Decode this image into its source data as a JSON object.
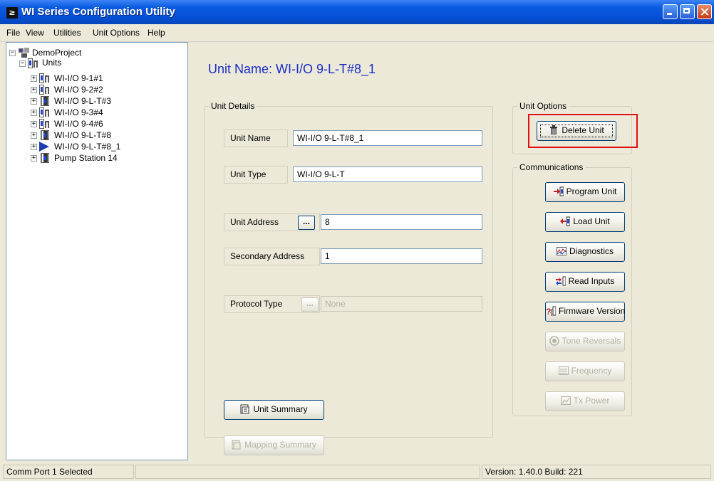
{
  "window": {
    "title": "WI Series Configuration Utility",
    "app_icon": "≥"
  },
  "menu": [
    "File",
    "View",
    "Utilities",
    "Unit Options",
    "Help"
  ],
  "tree": {
    "project": "DemoProject",
    "units_folder": "Units",
    "items": [
      {
        "label": "WI-I/O 9-1#1",
        "icon": "multi-unit-icon"
      },
      {
        "label": "WI-I/O 9-2#2",
        "icon": "multi-unit-icon"
      },
      {
        "label": "WI-I/O 9-L-T#3",
        "icon": "unit-icon"
      },
      {
        "label": "WI-I/O 9-3#4",
        "icon": "multi-unit-icon"
      },
      {
        "label": "WI-I/O 9-4#6",
        "icon": "multi-unit-icon"
      },
      {
        "label": "WI-I/O 9-L-T#8",
        "icon": "unit-icon"
      },
      {
        "label": "WI-I/O 9-L-T#8_1",
        "icon": "selected-arrow-icon"
      },
      {
        "label": "Pump Station 14",
        "icon": "unit-icon"
      }
    ]
  },
  "main": {
    "heading": "Unit Name: WI-I/O 9-L-T#8_1",
    "unit_details": {
      "title": "Unit Details",
      "unit_name_label": "Unit Name",
      "unit_name_value": "WI-I/O 9-L-T#8_1",
      "unit_type_label": "Unit Type",
      "unit_type_value": "WI-I/O 9-L-T",
      "unit_address_label": "Unit Address",
      "unit_address_button": "...",
      "unit_address_value": "8",
      "secondary_address_label": "Secondary Address",
      "secondary_address_value": "1",
      "protocol_type_label": "Protocol Type",
      "protocol_type_button": "...",
      "protocol_type_value": "None",
      "unit_summary_button": "Unit Summary",
      "mapping_summary_button": "Mapping Summary"
    },
    "unit_options": {
      "title": "Unit Options",
      "delete_button": "Delete Unit"
    },
    "communications": {
      "title": "Communications",
      "buttons": [
        {
          "label": "Program Unit",
          "enabled": true
        },
        {
          "label": "Load Unit",
          "enabled": true
        },
        {
          "label": "Diagnostics",
          "enabled": true
        },
        {
          "label": "Read Inputs",
          "enabled": true
        },
        {
          "label": "Firmware Version",
          "enabled": true
        },
        {
          "label": "Tone Reversals",
          "enabled": false
        },
        {
          "label": "Frequency",
          "enabled": false
        },
        {
          "label": "Tx Power",
          "enabled": false
        }
      ]
    }
  },
  "status": {
    "left": "Comm Port 1 Selected",
    "middle": "",
    "version": "Version: 1.40.0 Build: 221"
  },
  "colors": {
    "title_bar": "#0550d6",
    "heading": "#1b2fc8",
    "highlight": "#e01010",
    "face": "#ece9d8"
  }
}
